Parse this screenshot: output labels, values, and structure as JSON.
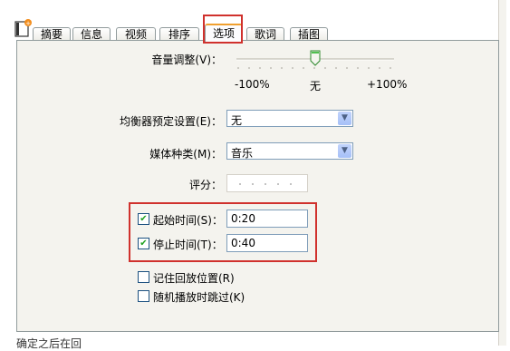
{
  "tabs": [
    "摘要",
    "信息",
    "视频",
    "排序",
    "选项",
    "歌词",
    "插图"
  ],
  "active_tab": "选项",
  "volume": {
    "label": "音量调整(V)：",
    "min_label": "-100%",
    "mid_label": "无",
    "max_label": "+100%"
  },
  "eq": {
    "label": "均衡器预定设置(E)：",
    "value": "无"
  },
  "media": {
    "label": "媒体种类(M)：",
    "value": "音乐"
  },
  "rating": {
    "label": "评分："
  },
  "start": {
    "label": "起始时间(S)：",
    "value": "0:20",
    "checked": true
  },
  "stop": {
    "label": "停止时间(T)：",
    "value": "0:40",
    "checked": true
  },
  "remember": {
    "label": "记住回放位置(R)",
    "checked": false
  },
  "skip": {
    "label": "随机播放时跳过(K)",
    "checked": false
  },
  "caption": "确定之后在回"
}
